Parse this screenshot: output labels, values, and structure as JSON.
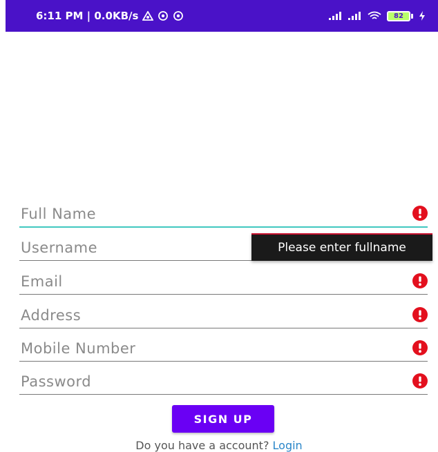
{
  "status_bar": {
    "text": "6:11 PM | 0.0KB/s",
    "battery": "82",
    "colors": {
      "background": "#4a12c8"
    }
  },
  "form": {
    "fields": [
      {
        "label": "Full Name",
        "focused": true,
        "error_icon": "alert-circle-icon"
      },
      {
        "label": "Username",
        "focused": false
      },
      {
        "label": "Email",
        "focused": false,
        "error_icon": "alert-circle-icon"
      },
      {
        "label": "Address",
        "focused": false,
        "error_icon": "alert-circle-icon"
      },
      {
        "label": "Mobile Number",
        "focused": false,
        "error_icon": "alert-circle-icon"
      },
      {
        "label": "Password",
        "focused": false,
        "error_icon": "alert-circle-icon"
      }
    ],
    "error_tooltip": "Please enter fullname",
    "colors": {
      "error": "#e3101e",
      "focus_underline": "#3fc8c0"
    }
  },
  "signup_button": {
    "label": "SIGN UP",
    "color": "#6a00f4"
  },
  "login_prompt": {
    "text": "Do you have a account?",
    "link": "Login",
    "link_color": "#2a86c9"
  }
}
